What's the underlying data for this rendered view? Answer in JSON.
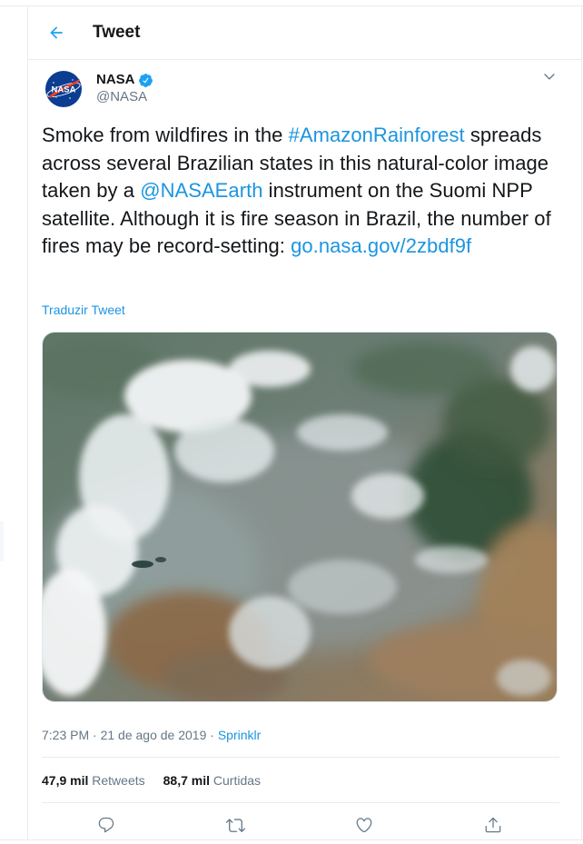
{
  "header": {
    "title": "Tweet"
  },
  "tweet": {
    "author": {
      "name": "NASA",
      "handle": "@NASA",
      "avatar_text": "NASA"
    },
    "text": {
      "part1": "Smoke from wildfires in the ",
      "hashtag": "#AmazonRainforest",
      "part2": " spreads across several Brazilian states in this natural-color image taken by a ",
      "mention": "@NASAEarth",
      "part3": " instrument on the Suomi NPP satellite. Although it is fire season in Brazil, the number of fires may be record-setting: ",
      "url": "go.nasa.gov/2zbdf9f"
    },
    "translate_label": "Traduzir Tweet",
    "meta": {
      "time": "7:23 PM",
      "separator": " · ",
      "date": "21 de ago de 2019",
      "separator2": " · ",
      "source": "Sprinklr"
    },
    "stats": {
      "retweets_count": "47,9 mil",
      "retweets_label": "Retweets",
      "likes_count": "88,7 mil",
      "likes_label": "Curtidas"
    }
  },
  "icons": {
    "back": "arrow-left-icon",
    "verified": "verified-badge-icon",
    "caret": "chevron-down-icon",
    "reply": "reply-icon",
    "retweet": "retweet-icon",
    "like": "heart-icon",
    "share": "share-icon"
  },
  "colors": {
    "accent": "#1da1f2",
    "link": "#1b95e0",
    "secondary_text": "#657786",
    "border": "#e6ecf0"
  }
}
